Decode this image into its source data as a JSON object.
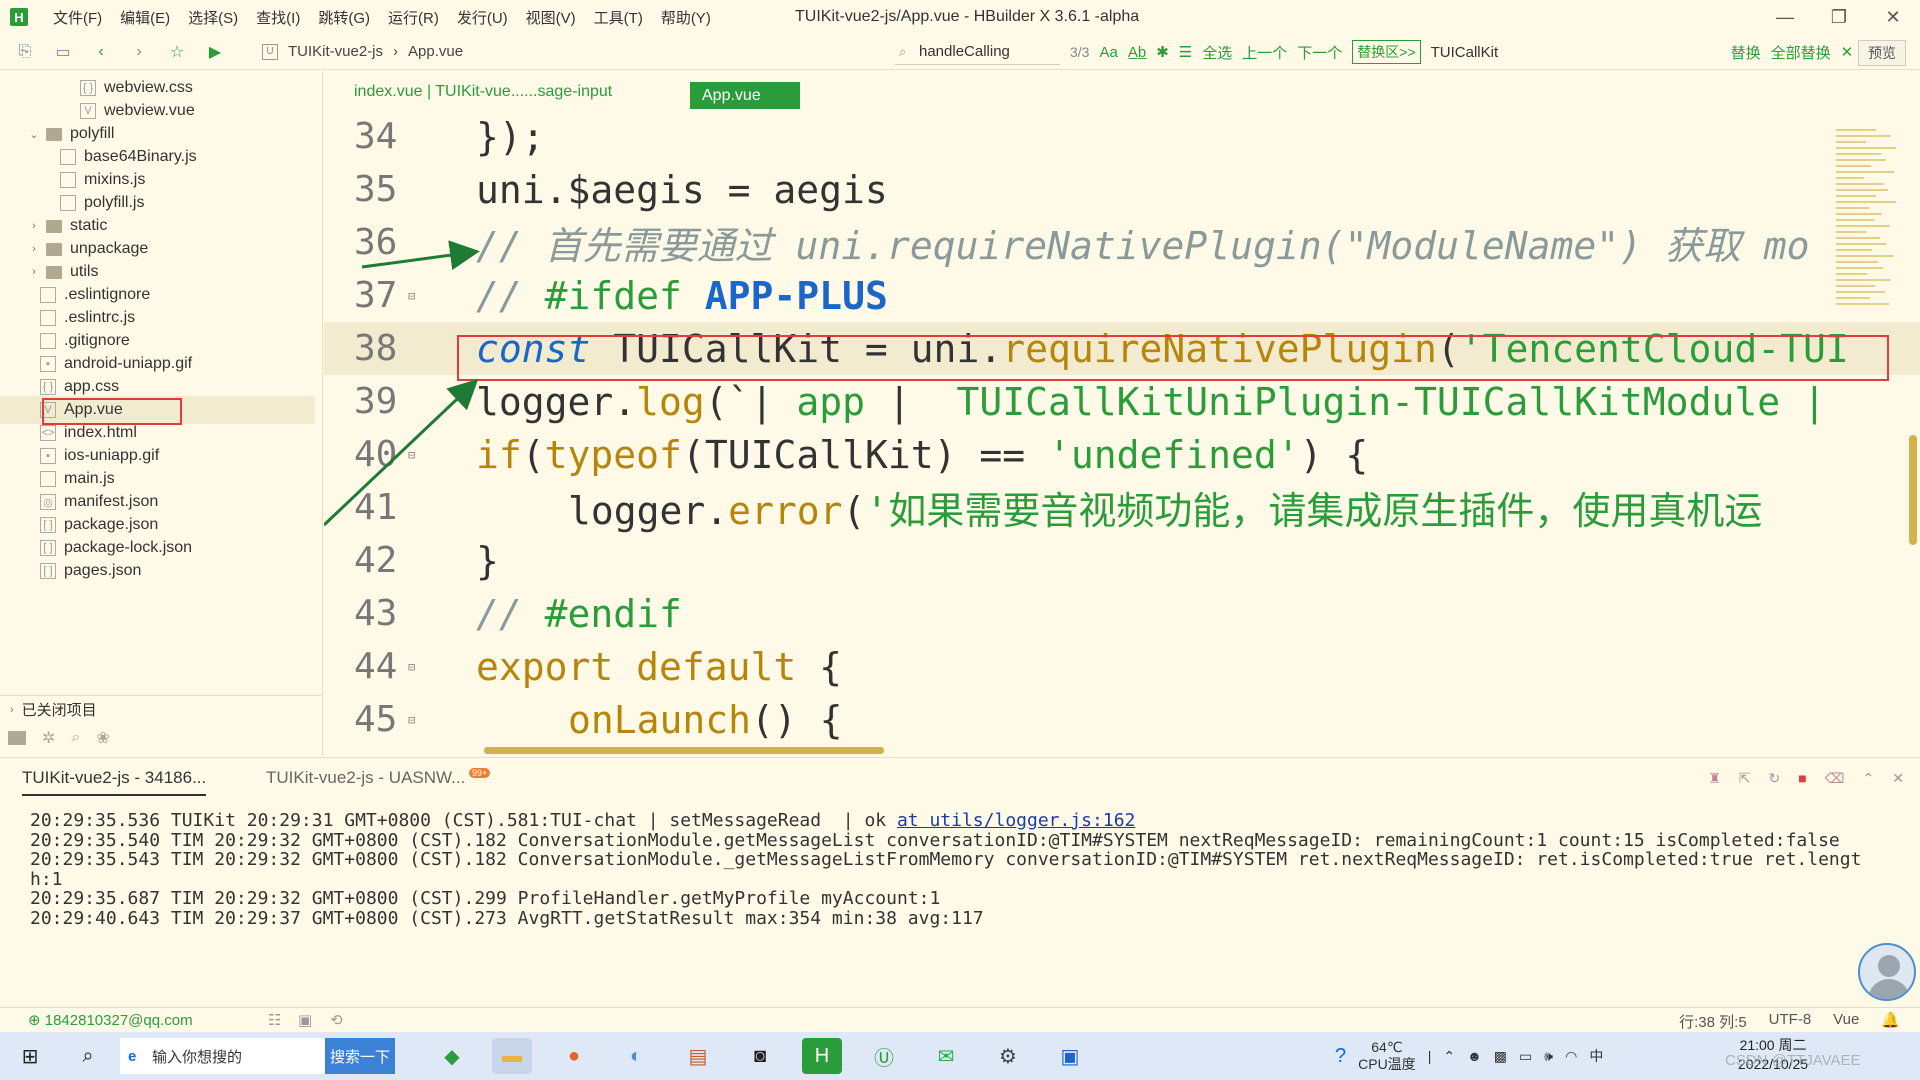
{
  "app": {
    "window_title": "TUIKit-vue2-js/App.vue - HBuilder X 3.6.1 -alpha",
    "logo": "H",
    "menu": [
      "文件(F)",
      "编辑(E)",
      "选择(S)",
      "查找(I)",
      "跳转(G)",
      "运行(R)",
      "发行(U)",
      "视图(V)",
      "工具(T)",
      "帮助(Y)"
    ],
    "window_controls": [
      "—",
      "❐",
      "✕"
    ]
  },
  "toolbar": {
    "breadcrumb_project": "TUIKit-vue2-js",
    "breadcrumb_file": "App.vue",
    "search_value": "handleCalling",
    "search_count": "3/3",
    "case_label": "Aa",
    "word_label": "A̲b̲",
    "select_all": "全选",
    "prev": "上一个",
    "next": "下一个",
    "replace_area": "替换区>>",
    "replace_value": "TUICallKit",
    "replace": "替换",
    "replace_all": "全部替换",
    "close": "✕",
    "preview": "预览"
  },
  "sidebar": {
    "items": [
      {
        "label": "webview.css",
        "indent": 3,
        "icon": "css-file-icon",
        "glyph": "{ }"
      },
      {
        "label": "webview.vue",
        "indent": 3,
        "icon": "vue-file-icon",
        "glyph": "V"
      },
      {
        "label": "polyfill",
        "indent": 1,
        "icon": "folder-icon",
        "expanded": true
      },
      {
        "label": "base64Binary.js",
        "indent": 2,
        "icon": "js-file-icon",
        "glyph": ""
      },
      {
        "label": "mixins.js",
        "indent": 2,
        "icon": "js-file-icon",
        "glyph": ""
      },
      {
        "label": "polyfill.js",
        "indent": 2,
        "icon": "js-file-icon",
        "glyph": ""
      },
      {
        "label": "static",
        "indent": 1,
        "icon": "folder-icon",
        "expanded": false
      },
      {
        "label": "unpackage",
        "indent": 1,
        "icon": "folder-icon",
        "expanded": false
      },
      {
        "label": "utils",
        "indent": 1,
        "icon": "folder-icon",
        "expanded": false
      },
      {
        "label": ".eslintignore",
        "indent": 1,
        "icon": "file-icon",
        "glyph": ""
      },
      {
        "label": ".eslintrc.js",
        "indent": 1,
        "icon": "js-file-icon",
        "glyph": ""
      },
      {
        "label": ".gitignore",
        "indent": 1,
        "icon": "file-icon",
        "glyph": ""
      },
      {
        "label": "android-uniapp.gif",
        "indent": 1,
        "icon": "image-file-icon",
        "glyph": "▪"
      },
      {
        "label": "app.css",
        "indent": 1,
        "icon": "css-file-icon",
        "glyph": "{ }"
      },
      {
        "label": "App.vue",
        "indent": 1,
        "icon": "vue-file-icon",
        "glyph": "V",
        "selected": true
      },
      {
        "label": "index.html",
        "indent": 1,
        "icon": "html-file-icon",
        "glyph": "<>"
      },
      {
        "label": "ios-uniapp.gif",
        "indent": 1,
        "icon": "image-file-icon",
        "glyph": "▪"
      },
      {
        "label": "main.js",
        "indent": 1,
        "icon": "js-file-icon",
        "glyph": ""
      },
      {
        "label": "manifest.json",
        "indent": 1,
        "icon": "manifest-file-icon",
        "glyph": "◎"
      },
      {
        "label": "package.json",
        "indent": 1,
        "icon": "json-file-icon",
        "glyph": "[ ]"
      },
      {
        "label": "package-lock.json",
        "indent": 1,
        "icon": "json-file-icon",
        "glyph": "[ ]"
      },
      {
        "label": "pages.json",
        "indent": 1,
        "icon": "json-file-icon",
        "glyph": "[ ]"
      }
    ],
    "closed_projects": "已关闭项目"
  },
  "editor": {
    "tab_inactive": "index.vue | TUIKit-vue......sage-input",
    "tab_active": "App.vue",
    "lines": [
      {
        "no": "34",
        "fold": "",
        "indent": 0,
        "tokens": [
          {
            "t": "});",
            "c": ""
          }
        ]
      },
      {
        "no": "35",
        "fold": "",
        "indent": 0,
        "tokens": [
          {
            "t": "uni.$aegis = aegis",
            "c": ""
          }
        ]
      },
      {
        "no": "36",
        "fold": "",
        "indent": 0,
        "tokens": [
          {
            "t": "// 首先需要通过 uni.requireNativePlugin(\"ModuleName\") 获取 mo",
            "c": "cmt"
          }
        ]
      },
      {
        "no": "37",
        "fold": "⊟",
        "indent": 0,
        "tokens": [
          {
            "t": "// ",
            "c": "cmt"
          },
          {
            "t": "#ifdef ",
            "c": "str"
          },
          {
            "t": "APP-PLUS",
            "c": "macro"
          }
        ]
      },
      {
        "no": "38",
        "fold": "",
        "indent": 0,
        "hl": true,
        "tokens": [
          {
            "t": "const",
            "c": "kw-blue"
          },
          {
            "t": " TUICallKit = uni.",
            "c": ""
          },
          {
            "t": "requireNativePlugin",
            "c": "fn"
          },
          {
            "t": "(",
            "c": ""
          },
          {
            "t": "'TencentCloud-TUI",
            "c": "str"
          }
        ]
      },
      {
        "no": "39",
        "fold": "",
        "indent": 0,
        "tokens": [
          {
            "t": "logger.",
            "c": ""
          },
          {
            "t": "log",
            "c": "fn"
          },
          {
            "t": "(`| ",
            "c": ""
          },
          {
            "t": "app",
            "c": "str"
          },
          {
            "t": " |  ",
            "c": ""
          },
          {
            "t": "TUICallKitUniPlugin-TUICallKitModule |",
            "c": "str"
          }
        ]
      },
      {
        "no": "40",
        "fold": "⊟",
        "indent": 0,
        "tokens": [
          {
            "t": "if",
            "c": "kw"
          },
          {
            "t": "(",
            "c": ""
          },
          {
            "t": "typeof",
            "c": "kw"
          },
          {
            "t": "(TUICallKit) == ",
            "c": ""
          },
          {
            "t": "'undefined'",
            "c": "str"
          },
          {
            "t": ") {",
            "c": ""
          }
        ]
      },
      {
        "no": "41",
        "fold": "",
        "indent": 1,
        "tokens": [
          {
            "t": "logger.",
            "c": ""
          },
          {
            "t": "error",
            "c": "fn"
          },
          {
            "t": "(",
            "c": ""
          },
          {
            "t": "'如果需要音视频功能，请集成原生插件，使用真机运",
            "c": "str"
          }
        ]
      },
      {
        "no": "42",
        "fold": "",
        "indent": 0,
        "tokens": [
          {
            "t": "}",
            "c": ""
          }
        ]
      },
      {
        "no": "43",
        "fold": "",
        "indent": 0,
        "tokens": [
          {
            "t": "// ",
            "c": "cmt"
          },
          {
            "t": "#endif",
            "c": "str"
          }
        ]
      },
      {
        "no": "44",
        "fold": "⊟",
        "indent": 0,
        "tokens": [
          {
            "t": "export default",
            "c": "kw"
          },
          {
            "t": " {",
            "c": ""
          }
        ]
      },
      {
        "no": "45",
        "fold": "⊟",
        "indent": 1,
        "tokens": [
          {
            "t": "onLaunch",
            "c": "fn"
          },
          {
            "t": "() {",
            "c": ""
          }
        ]
      }
    ]
  },
  "console": {
    "tab_1": "TUIKit-vue2-js - 34186...",
    "tab_2": "TUIKit-vue2-js - UASNW...",
    "badge": "99+",
    "logs": [
      {
        "text": "20:29:35.536 TUIKit 20:29:31 GMT+0800 (CST).581:TUI-chat | setMessageRead  | ok ",
        "link": "at utils/logger.js:162"
      },
      {
        "text": "20:29:35.540 TIM 20:29:32 GMT+0800 (CST).182 ConversationModule.getMessageList conversationID:@TIM#SYSTEM nextReqMessageID: remainingCount:1 count:15 isCompleted:false",
        "link": ""
      },
      {
        "text": "20:29:35.543 TIM 20:29:32 GMT+0800 (CST).182 ConversationModule._getMessageListFromMemory conversationID:@TIM#SYSTEM ret.nextReqMessageID: ret.isCompleted:true ret.lengt",
        "link": ""
      },
      {
        "text": "h:1",
        "link": ""
      },
      {
        "text": "20:29:35.687 TIM 20:29:32 GMT+0800 (CST).299 ProfileHandler.getMyProfile myAccount:1",
        "link": ""
      },
      {
        "text": "20:29:40.643 TIM 20:29:37 GMT+0800 (CST).273 AvgRTT.getStatResult max:354 min:38 avg:117",
        "link": ""
      }
    ]
  },
  "statusbar": {
    "user": "1842810327@qq.com",
    "position": "行:38  列:5",
    "encoding": "UTF-8",
    "language": "Vue"
  },
  "taskbar": {
    "search_placeholder": "输入你想搜的",
    "search_button": "搜索一下",
    "temp": "64℃",
    "temp_label": "CPU温度",
    "ime": "中",
    "time": "21:00 周二",
    "date": "2022/10/25",
    "watermark": "CSDN @TTJAVAEE"
  },
  "colors": {
    "accent": "#2a9d3a",
    "highlight_red": "#e23b3b",
    "background": "#fffae8"
  }
}
